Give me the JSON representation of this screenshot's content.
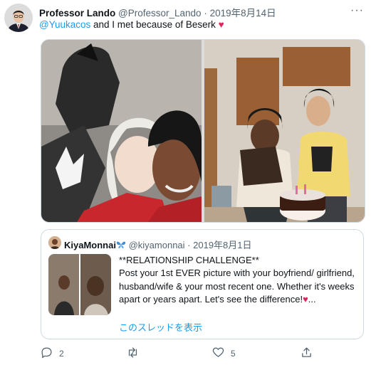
{
  "author": {
    "name": "Professor Lando",
    "handle": "@Professor_Lando",
    "separator": "·",
    "date": "2019年8月14日"
  },
  "tweet": {
    "mention": "@Yuukacos",
    "text": " and I met because of Beserk ",
    "emoji": "♥"
  },
  "quote": {
    "name": "KiyaMonnai",
    "badge_emoji": "butterfly",
    "handle": "@kiyamonnai",
    "separator": "·",
    "date": "2019年8月1日",
    "lines": [
      "**RELATIONSHIP CHALLENGE**",
      "Post your 1st EVER picture with your boyfriend/ girlfriend, husband/wife & your most recent one. Whether it's weeks apart or years apart. Let's see the difference!"
    ],
    "ellipsis": "...",
    "thread_link": "このスレッドを表示"
  },
  "actions": {
    "reply_count": "2",
    "retweet_count": "",
    "like_count": "5"
  },
  "colors": {
    "accent": "#1d9bf0",
    "heart": "#e0245e",
    "muted": "#536471",
    "border": "#cfd9de"
  }
}
